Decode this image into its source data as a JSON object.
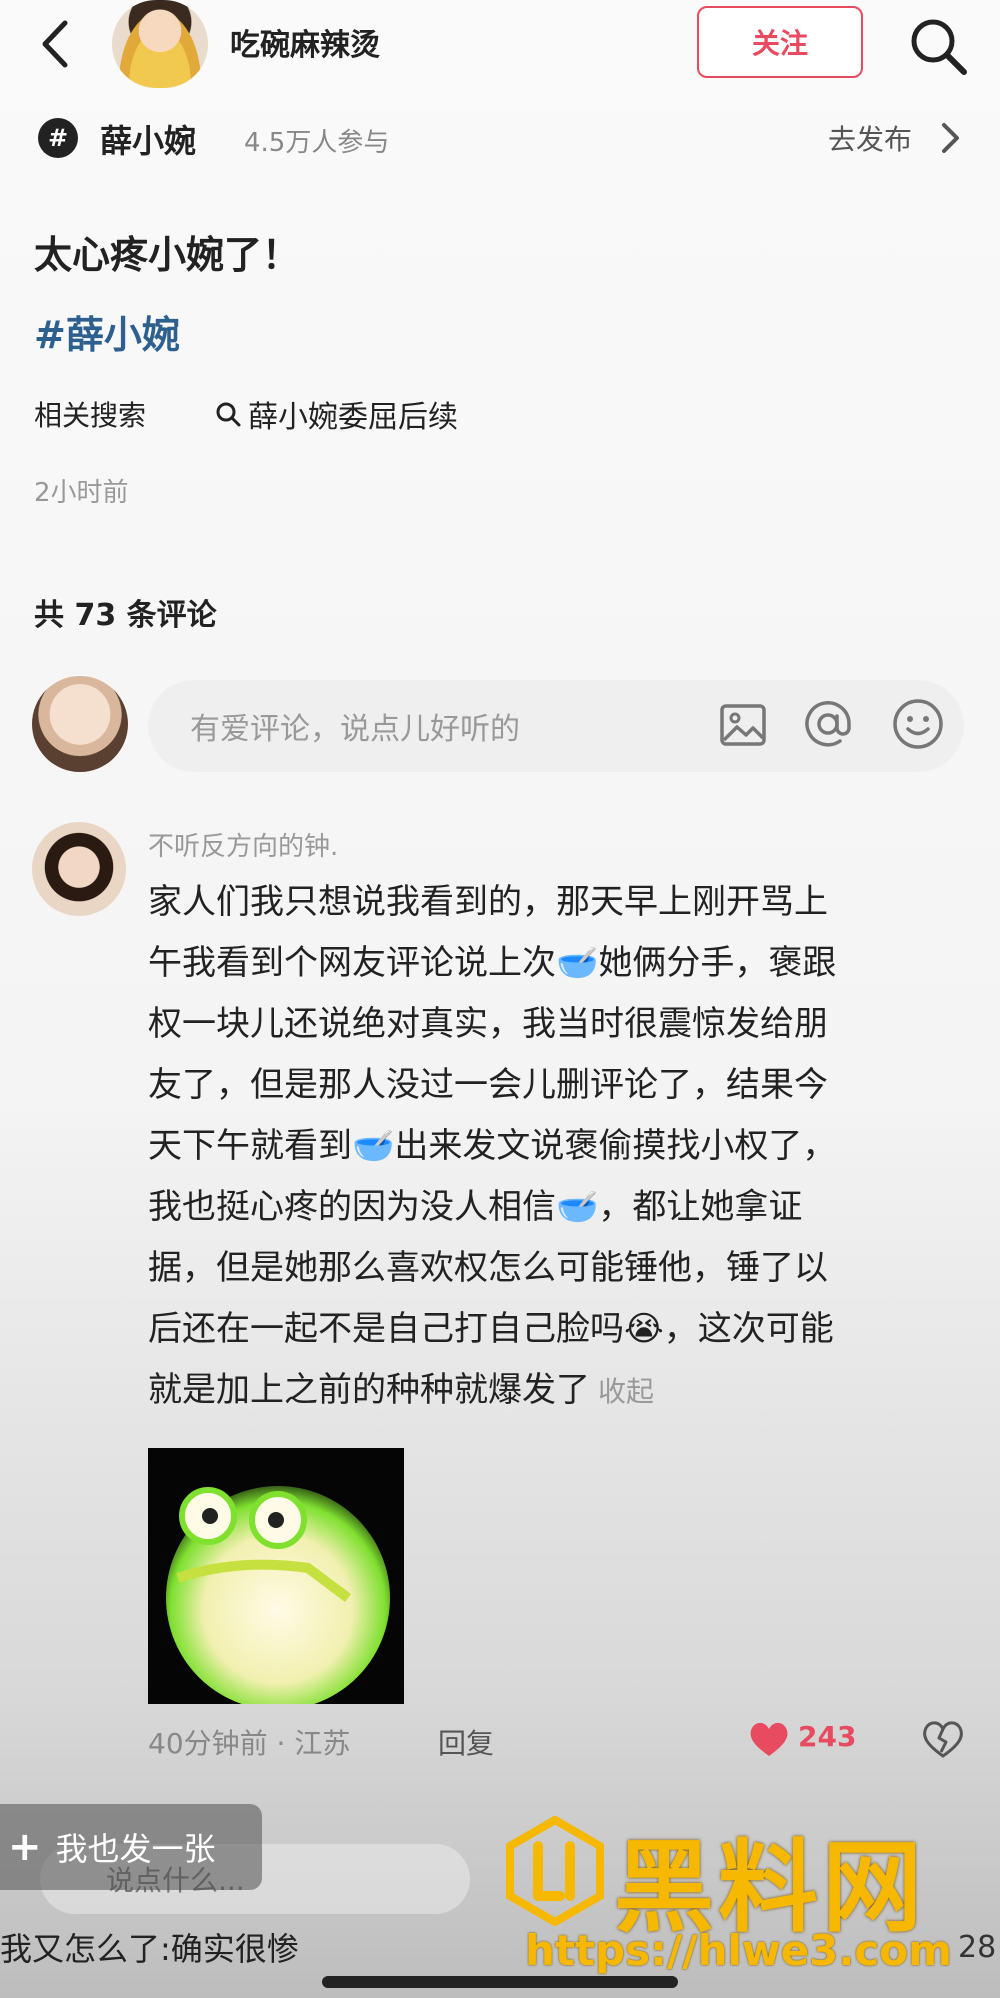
{
  "header": {
    "username": "吃碗麻辣烫",
    "follow_label": "关注"
  },
  "topic": {
    "hash_symbol": "#",
    "name": "薛小婉",
    "participants": "4.5万人参与",
    "publish_label": "去发布"
  },
  "post": {
    "title": "太心疼小婉了！",
    "tag": "#薛小婉",
    "related_label": "相关搜索",
    "related_query": "薛小婉委屈后续",
    "time": "2小时前"
  },
  "comments": {
    "count_label": "共 73 条评论",
    "input_placeholder": "有爱评论，说点儿好听的",
    "items": [
      {
        "name": "不听反方向的钟.",
        "lines": [
          "家人们我只想说我看到的，那天早上刚开骂上",
          "午我看到个网友评论说上次🥣她俩分手，褒跟",
          "权一块儿还说绝对真实，我当时很震惊发给朋",
          "友了，但是那人没过一会儿删评论了，结果今",
          "天下午就看到🥣出来发文说褒偷摸找小权了，",
          "我也挺心疼的因为没人相信🥣，都让她拿证",
          "据，但是她那么喜欢权怎么可能锤他，锤了以",
          "后还在一起不是自己打自己脸吗😭，这次可能",
          "就是加上之前的种种就爆发了"
        ],
        "collapse_label": "收起",
        "meta": "40分钟前 · 江苏",
        "reply_label": "回复",
        "likes": "243"
      }
    ]
  },
  "overlay": {
    "post_one_label": "我也发一张",
    "say_something": "说点什么...",
    "caption": "我又怎么了:确实很惨",
    "watermark_text": "黑料网",
    "watermark_url": "https://hlwe3.com",
    "page_number": "28"
  },
  "colors": {
    "accent": "#e84a5f",
    "tag_blue": "#2d5f8f",
    "watermark": "#f6b800"
  },
  "icons": [
    "back-arrow-icon",
    "search-icon",
    "hashtag-icon",
    "chevron-right-icon",
    "search-small-icon",
    "image-icon",
    "at-icon",
    "emoji-icon",
    "heart-icon",
    "broken-heart-icon",
    "plus-icon"
  ]
}
